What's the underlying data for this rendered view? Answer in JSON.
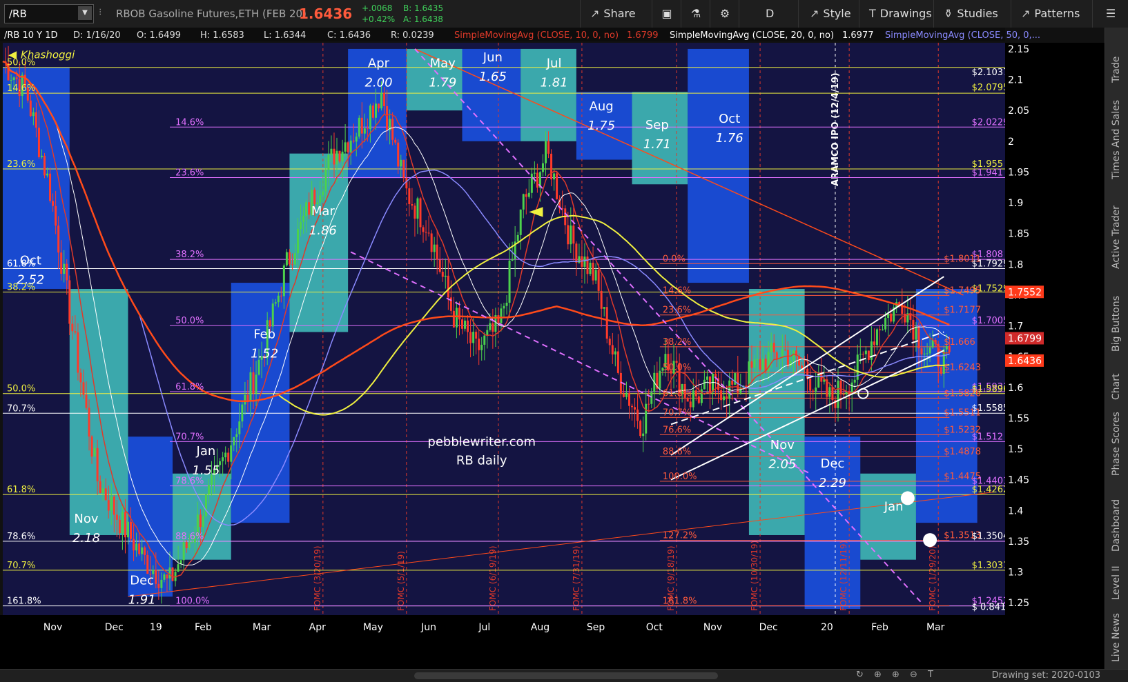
{
  "toolbar": {
    "symbol": "/RB",
    "description": "RBOB Gasoline Futures,ETH (FEB 20)",
    "last": "1.6436",
    "net_change": "+.0068",
    "pct_change": "+0.42%",
    "bid": "B: 1.6435",
    "ask": "A: 1.6438",
    "share": "Share",
    "period": "D",
    "style": "Style",
    "drawings": "Drawings",
    "studies": "Studies",
    "patterns": "Patterns"
  },
  "side_tabs": [
    "Trade",
    "Times And Sales",
    "Active Trader",
    "Big Buttons",
    "Chart",
    "Phase Scores",
    "Dashboard",
    "Level II",
    "Live News"
  ],
  "bottom": {
    "drawing_set": "Drawing set: 2020-0103"
  },
  "colors": {
    "bg": "#141442",
    "sma10": "#e03a2a",
    "sma20": "#ffffff",
    "sma50": "#8a8aff",
    "sma200": "#ff4a1a",
    "sma100": "#f0f040",
    "magenta": "#e070ff",
    "yellow": "#f0f040",
    "red_label": "#ff5a3c",
    "teal_box": "#3fb8b8",
    "blue_box": "#1a50e0"
  },
  "chart_data": {
    "type": "candlestick",
    "header": {
      "title": "/RB 10 Y 1D",
      "date": "D: 1/16/20",
      "open": "O: 1.6499",
      "high": "H: 1.6583",
      "low": "L: 1.6344",
      "close": "C: 1.6436",
      "range": "R: 0.0239",
      "sma10": "SimpleMovingAvg (CLOSE, 10, 0, no)",
      "sma10_val": "1.6799",
      "sma20": "SimpleMovingAvg (CLOSE, 20, 0, no)",
      "sma20_val": "1.6977",
      "sma50": "SimpleMovingAvg (CLOSE, 50, 0,..."
    },
    "watermark": [
      "pebblewriter.com",
      "RB daily"
    ],
    "annotation_vertical": "ARAMCO IPO (12/4/19)",
    "khashoggi": "Khashoggi",
    "x_labels": [
      "Nov",
      "Dec",
      "19",
      "Feb",
      "Mar",
      "Apr",
      "May",
      "Jun",
      "Jul",
      "Aug",
      "Sep",
      "Oct",
      "Nov",
      "Dec",
      "20",
      "Feb",
      "Mar"
    ],
    "y_ticks": [
      1.25,
      1.3,
      1.35,
      1.4,
      1.45,
      1.5,
      1.55,
      1.6,
      1.65,
      1.7,
      1.75,
      1.8,
      1.85,
      1.9,
      1.95,
      2,
      2.05,
      2.1,
      2.15
    ],
    "y_tick_labels": [
      "1.25",
      "1.3",
      "1.35",
      "1.4",
      "1.45",
      "1.5",
      "1.55",
      "1.6",
      "1.65",
      "1.7",
      "1.75",
      "1.8",
      "1.85",
      "1.9",
      "1.95",
      "2",
      "2.05",
      "2.1",
      "2.15"
    ],
    "ylim": [
      1.23,
      2.16
    ],
    "price_tags": [
      {
        "text": "1.7552",
        "value": 1.7552,
        "color": "#ff3a1a"
      },
      {
        "text": "1.6799",
        "value": 1.6799,
        "color": "#d02a2a"
      },
      {
        "text": "1.6436",
        "value": 1.6436,
        "color": "#ff3a1a"
      }
    ],
    "fomc": [
      "FOMC (3/20/19)",
      "FOMC (5/1/19)",
      "FOMC (6/19/19)",
      "FOMC (7/31/19)",
      "FOMC (9/18/19)",
      "FOMC (10/30/19)",
      "FOMC (12/11/19)",
      "FOMC (1/29/20)"
    ],
    "season_boxes": [
      {
        "name": "Oct",
        "value": "2.52"
      },
      {
        "name": "Nov",
        "value": "2.18"
      },
      {
        "name": "Dec",
        "value": "1.91"
      },
      {
        "name": "Jan",
        "value": "1.55"
      },
      {
        "name": "Feb",
        "value": "1.52"
      },
      {
        "name": "Mar",
        "value": "1.86"
      },
      {
        "name": "Apr",
        "value": "2.00"
      },
      {
        "name": "May",
        "value": "1.79"
      },
      {
        "name": "Jun",
        "value": "1.65"
      },
      {
        "name": "Jul",
        "value": "1.81"
      },
      {
        "name": "Aug",
        "value": "1.75"
      },
      {
        "name": "Sep",
        "value": "1.71"
      },
      {
        "name": "Oct",
        "value": "1.76"
      },
      {
        "name": "Nov",
        "value": "2.05"
      },
      {
        "name": "Dec",
        "value": "2.29"
      },
      {
        "name": "Jan",
        "value": ""
      }
    ],
    "right_labels": [
      {
        "text": "$2.1037",
        "value": 2.1037,
        "color": "#ffffff"
      },
      {
        "text": "$2.0795",
        "value": 2.0795,
        "color": "#f0f040"
      },
      {
        "text": "$2.0229",
        "value": 2.0229,
        "color": "#e070ff"
      },
      {
        "text": "$1.955",
        "value": 1.955,
        "color": "#f0f040"
      },
      {
        "text": "$1.941",
        "value": 1.941,
        "color": "#e070ff"
      },
      {
        "text": "$1.808",
        "value": 1.808,
        "color": "#e070ff"
      },
      {
        "text": "$1.8011",
        "value": 1.8011,
        "color": "#ff5a3c"
      },
      {
        "text": "$1.7929",
        "value": 1.7929,
        "color": "#ffffff"
      },
      {
        "text": "$1.7529",
        "value": 1.7529,
        "color": "#f0f040"
      },
      {
        "text": "$1.7495",
        "value": 1.7495,
        "color": "#ff5a3c"
      },
      {
        "text": "$1.7177",
        "value": 1.7177,
        "color": "#ff5a3c"
      },
      {
        "text": "$1.7005",
        "value": 1.7005,
        "color": "#e070ff"
      },
      {
        "text": "$1.666",
        "value": 1.666,
        "color": "#ff5a3c"
      },
      {
        "text": "$1.6243",
        "value": 1.6243,
        "color": "#ff5a3c"
      },
      {
        "text": "$1.5931",
        "value": 1.5931,
        "color": "#e070ff"
      },
      {
        "text": "$1.5896",
        "value": 1.5896,
        "color": "#f0f040"
      },
      {
        "text": "$1.5826",
        "value": 1.5826,
        "color": "#ff5a3c"
      },
      {
        "text": "$1.5585",
        "value": 1.5585,
        "color": "#ffffff"
      },
      {
        "text": "$1.5511",
        "value": 1.5511,
        "color": "#ff5a3c"
      },
      {
        "text": "$1.5232",
        "value": 1.5232,
        "color": "#ff5a3c"
      },
      {
        "text": "$1.512",
        "value": 1.512,
        "color": "#e070ff"
      },
      {
        "text": "$1.4878",
        "value": 1.4878,
        "color": "#ff5a3c"
      },
      {
        "text": "$1.4475",
        "value": 1.4475,
        "color": "#ff5a3c"
      },
      {
        "text": "$1.4401",
        "value": 1.4401,
        "color": "#e070ff"
      },
      {
        "text": "$1.4262",
        "value": 1.4262,
        "color": "#f0f040"
      },
      {
        "text": "$1.3513",
        "value": 1.3513,
        "color": "#ff5a3c"
      },
      {
        "text": "$1.3504",
        "value": 1.3504,
        "color": "#ffffff"
      },
      {
        "text": "$1.3031",
        "value": 1.3031,
        "color": "#f0f040"
      },
      {
        "text": "$1.2452",
        "value": 1.2452,
        "color": "#e070ff"
      },
      {
        "text": "$ 0.8411",
        "value": 1.235,
        "color": "#ffffff"
      }
    ],
    "fib_yellow": [
      {
        "label": "50.0%",
        "value": 2.12
      },
      {
        "label": "14.6%",
        "value": 2.078
      },
      {
        "label": "23.6%",
        "value": 1.955
      },
      {
        "label": "38.2%",
        "value": 1.755
      },
      {
        "label": "50.0%",
        "value": 1.59
      },
      {
        "label": "61.8%",
        "value": 1.426
      },
      {
        "label": "70.7%",
        "value": 1.303
      }
    ],
    "fib_white": [
      {
        "label": "61.8%",
        "value": 1.793
      },
      {
        "label": "70.7%",
        "value": 1.558
      },
      {
        "label": "78.6%",
        "value": 1.35
      },
      {
        "label": "161.8%",
        "value": 1.245
      }
    ],
    "fib_magenta": [
      {
        "label": "14.6%",
        "value": 2.023
      },
      {
        "label": "23.6%",
        "value": 1.941
      },
      {
        "label": "38.2%",
        "value": 1.808
      },
      {
        "label": "50.0%",
        "value": 1.7005
      },
      {
        "label": "61.8%",
        "value": 1.593
      },
      {
        "label": "70.7%",
        "value": 1.512
      },
      {
        "label": "78.6%",
        "value": 1.44
      },
      {
        "label": "88.6%",
        "value": 1.35
      },
      {
        "label": "100.0%",
        "value": 1.245
      }
    ],
    "fib_red": [
      {
        "label": "0.0%",
        "value": 1.8011
      },
      {
        "label": "14.6%",
        "value": 1.7495
      },
      {
        "label": "23.6%",
        "value": 1.7177
      },
      {
        "label": "38.2%",
        "value": 1.666
      },
      {
        "label": "50.0%",
        "value": 1.6243
      },
      {
        "label": "61.8%",
        "value": 1.5826
      },
      {
        "label": "70.7%",
        "value": 1.5511
      },
      {
        "label": "76.6%",
        "value": 1.5232
      },
      {
        "label": "88.6%",
        "value": 1.4878
      },
      {
        "label": "100.0%",
        "value": 1.4475
      },
      {
        "label": "127.2%",
        "value": 1.3513
      },
      {
        "label": "161.8%",
        "value": 1.2452
      }
    ],
    "sma_anchor_closes": [
      2.13,
      2.08,
      1.92,
      1.68,
      1.45,
      1.38,
      1.32,
      1.28,
      1.36,
      1.45,
      1.55,
      1.66,
      1.8,
      1.9,
      1.98,
      2.02,
      2.08,
      1.92,
      1.86,
      1.72,
      1.66,
      1.7,
      1.9,
      1.98,
      1.84,
      1.78,
      1.62,
      1.54,
      1.66,
      1.58,
      1.6,
      1.6,
      1.64,
      1.66,
      1.62,
      1.58,
      1.62,
      1.7,
      1.74,
      1.66,
      1.64
    ],
    "legend": "none",
    "grid": false
  }
}
